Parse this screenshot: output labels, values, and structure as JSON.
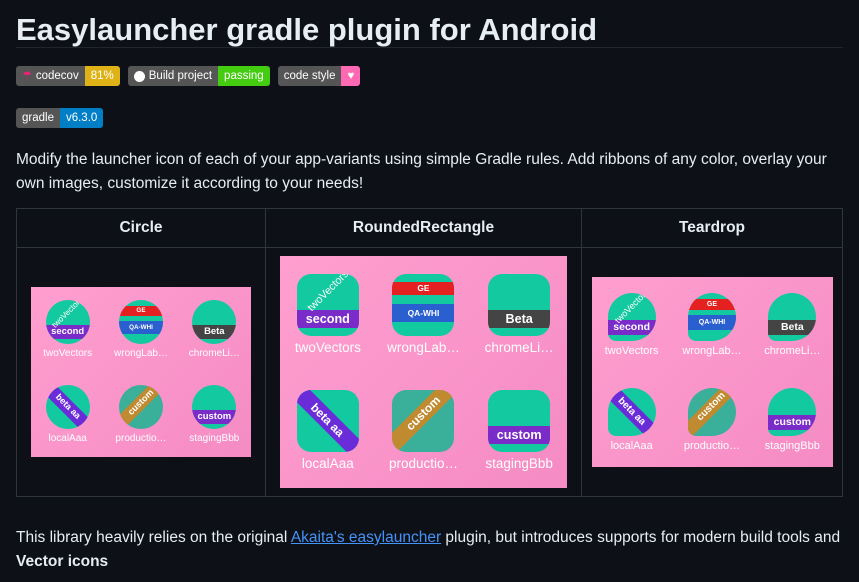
{
  "title": "Easylauncher gradle plugin for Android",
  "badges": [
    {
      "left": "codecov",
      "right": "81%",
      "color": "#dfb317",
      "icon": "umbrella-icon"
    },
    {
      "left": "Build project",
      "right": "passing",
      "color": "#4c1",
      "icon": "github-icon"
    },
    {
      "left": "code style",
      "right": "♥",
      "color": "#ff69b4",
      "icon": ""
    }
  ],
  "badge_gradle": {
    "left": "gradle",
    "right": "v6.3.0",
    "color": "#007ec6"
  },
  "description": "Modify the launcher icon of each of your app-variants using simple Gradle rules. Add ribbons of any color, overlay your own images, customize it according to your needs!",
  "table": {
    "headers": [
      "Circle",
      "RoundedRectangle",
      "Teardrop"
    ]
  },
  "icons": [
    {
      "label": "twoVectors",
      "ribbon": "second",
      "overlay": "twoVectors"
    },
    {
      "label": "wrongLab…",
      "ribbon": "QA-WHI",
      "top": "GE"
    },
    {
      "label": "chromeLi…",
      "ribbon": "Beta"
    },
    {
      "label": "localAaa",
      "ribbon": "beta",
      "extra": "aa"
    },
    {
      "label": "productio…",
      "ribbon": "custom"
    },
    {
      "label": "stagingBbb",
      "ribbon": "custom"
    }
  ],
  "footer": {
    "pre": "This library heavily relies on the original ",
    "link": "Akaita's easylauncher",
    "post": " plugin, but introduces supports for modern build tools and ",
    "bold": "Vector icons"
  }
}
